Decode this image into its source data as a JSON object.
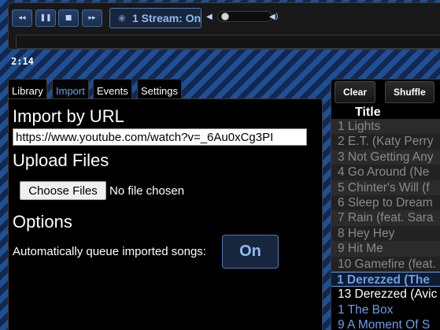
{
  "player": {
    "controls": {
      "previous_icon": "◂◂",
      "pause_icon": "❚❚",
      "stop_icon": "■",
      "next_icon": "▸▸"
    },
    "stream_button": {
      "icon": "rss-icon",
      "icon_glyph": "◉",
      "label": "1 Stream: On"
    },
    "volume": {
      "level": 0.05,
      "min_icon": "◀",
      "max_icon": "◀)"
    },
    "elapsed_time": "2:14"
  },
  "left_tabs": [
    {
      "label": "Library",
      "active": false
    },
    {
      "label": "Import",
      "active": true
    },
    {
      "label": "Events",
      "active": false
    },
    {
      "label": "Settings",
      "active": false
    }
  ],
  "import": {
    "heading": "Import by URL",
    "url_value": "https://www.youtube.com/watch?v=_6Au0xCg3PI",
    "upload_heading": "Upload Files",
    "choose_files_label": "Choose Files",
    "no_file_text": "No file chosen",
    "options_heading": "Options",
    "autoqueue_label": "Automatically queue imported songs:",
    "autoqueue_value": "On"
  },
  "queue": {
    "clear_label": "Clear",
    "shuffle_label": "Shuffle",
    "column_title": "Title",
    "rows": [
      {
        "text": "1 Lights",
        "state": "played"
      },
      {
        "text": "2 E.T. (Katy Perry",
        "state": "played"
      },
      {
        "text": "3 Not Getting Any",
        "state": "played"
      },
      {
        "text": "4 Go Around (Ne",
        "state": "played"
      },
      {
        "text": "5 Chinter's Will (f",
        "state": "played"
      },
      {
        "text": "6 Sleep to Dream",
        "state": "played"
      },
      {
        "text": "7 Rain (feat. Sara",
        "state": "played"
      },
      {
        "text": "8 Hey Hey",
        "state": "played"
      },
      {
        "text": "9 Hit Me",
        "state": "played"
      },
      {
        "text": "10 Gamefire (feat.",
        "state": "played"
      },
      {
        "text": "1 Derezzed (The",
        "state": "current"
      },
      {
        "text": "13 Derezzed (Avic",
        "state": "upcoming"
      },
      {
        "text": "1 The Box",
        "state": "next"
      },
      {
        "text": "9 A Moment Of S",
        "state": "next"
      }
    ]
  },
  "colors": {
    "accent": "#6a9eea",
    "panel_bg": "#000000",
    "played_text": "#8a8a8a",
    "stripe_light": "#1f4f94",
    "stripe_dark": "#12284f"
  }
}
